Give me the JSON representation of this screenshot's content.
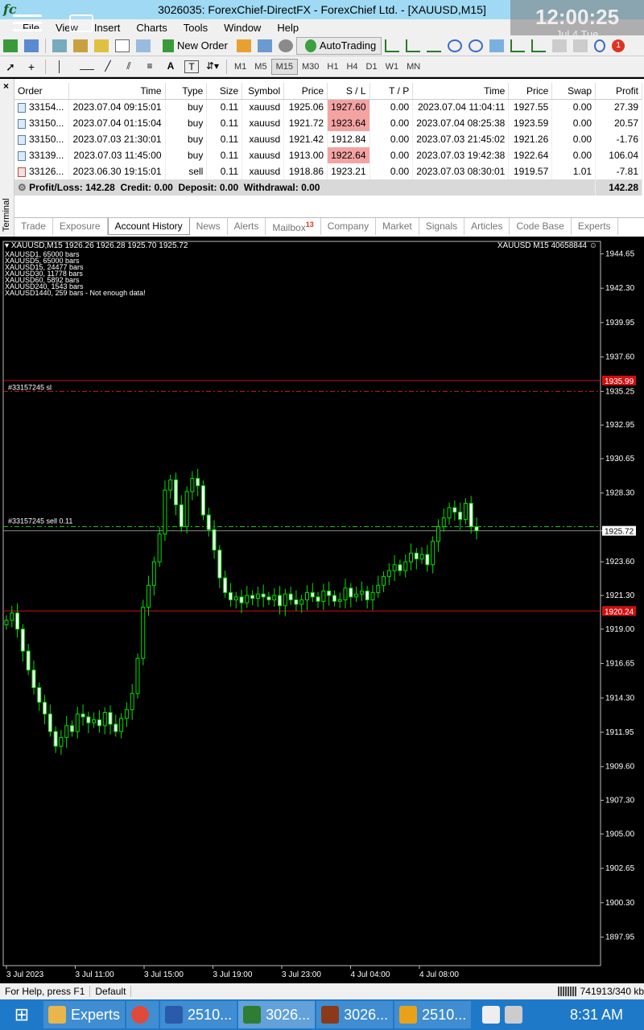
{
  "window": {
    "title": "3026035: ForexChief-DirectFX - ForexChief Ltd. - [XAUUSD,M15]",
    "logo": "fc"
  },
  "overlay": {
    "time": "12:00:25",
    "date": "Jul 4 Tue"
  },
  "menu": [
    "File",
    "View",
    "Insert",
    "Charts",
    "Tools",
    "Window",
    "Help"
  ],
  "toolbar": {
    "new_order": "New Order",
    "autotrading": "AutoTrading",
    "alert_badge": "1"
  },
  "timeframes": [
    "M1",
    "M5",
    "M15",
    "M30",
    "H1",
    "H4",
    "D1",
    "W1",
    "MN"
  ],
  "active_timeframe": "M15",
  "terminal": {
    "close": "×",
    "side_label": "Terminal",
    "columns": [
      "Order",
      "Time",
      "Type",
      "Size",
      "Symbol",
      "Price",
      "S / L",
      "T / P",
      "Time",
      "Price",
      "Swap",
      "Profit"
    ],
    "rows": [
      {
        "order": "33154...",
        "time": "2023.07.04 09:15:01",
        "type": "buy",
        "size": "0.11",
        "symbol": "xauusd",
        "price": "1925.06",
        "sl": "1927.60",
        "tp": "0.00",
        "ctime": "2023.07.04 11:04:11",
        "cprice": "1927.55",
        "swap": "0.00",
        "profit": "27.39",
        "sl_hit": true
      },
      {
        "order": "33150...",
        "time": "2023.07.04 01:15:04",
        "type": "buy",
        "size": "0.11",
        "symbol": "xauusd",
        "price": "1921.72",
        "sl": "1923.64",
        "tp": "0.00",
        "ctime": "2023.07.04 08:25:38",
        "cprice": "1923.59",
        "swap": "0.00",
        "profit": "20.57",
        "sl_hit": true
      },
      {
        "order": "33150...",
        "time": "2023.07.03 21:30:01",
        "type": "buy",
        "size": "0.11",
        "symbol": "xauusd",
        "price": "1921.42",
        "sl": "1912.84",
        "tp": "0.00",
        "ctime": "2023.07.03 21:45:02",
        "cprice": "1921.26",
        "swap": "0.00",
        "profit": "-1.76",
        "sl_hit": false
      },
      {
        "order": "33139...",
        "time": "2023.07.03 11:45:00",
        "type": "buy",
        "size": "0.11",
        "symbol": "xauusd",
        "price": "1913.00",
        "sl": "1922.64",
        "tp": "0.00",
        "ctime": "2023.07.03 19:42:38",
        "cprice": "1922.64",
        "swap": "0.00",
        "profit": "106.04",
        "sl_hit": true
      },
      {
        "order": "33126...",
        "time": "2023.06.30 19:15:01",
        "type": "sell",
        "size": "0.11",
        "symbol": "xauusd",
        "price": "1918.86",
        "sl": "1923.21",
        "tp": "0.00",
        "ctime": "2023.07.03 08:30:01",
        "cprice": "1919.57",
        "swap": "1.01",
        "profit": "-7.81",
        "sl_hit": false
      }
    ],
    "summary": "Profit/Loss: 142.28  Credit: 0.00  Deposit: 0.00  Withdrawal: 0.00",
    "summary_total": "142.28",
    "tabs": [
      "Trade",
      "Exposure",
      "Account History",
      "News",
      "Alerts",
      "Mailbox",
      "Company",
      "Market",
      "Signals",
      "Articles",
      "Code Base",
      "Experts"
    ],
    "mailbox_count": "13",
    "active_tab": "Account History"
  },
  "chart_panel": {
    "header": "XAUUSD,M15  1926.26 1926.28 1925.70 1925.72",
    "header_right": "XAUUSD M15 40658844",
    "info_lines": [
      "XAUUSD1, 65000 bars",
      "XAUUSD5, 65000 bars",
      "XAUUSD15, 24477 bars",
      "XAUUSD30, 11778 bars",
      "XAUUSD60, 5892 bars",
      "XAUUSD240, 1543 bars",
      "XAUUSD1440, 259 bars - Not enough data!"
    ],
    "sl_label": "#33157245 sl",
    "order_label": "#33157245 sell 0.11"
  },
  "chart_data": {
    "type": "candlestick",
    "symbol": "XAUUSD",
    "timeframe": "M15",
    "y_ticks": [
      1944.65,
      1942.3,
      1939.95,
      1937.6,
      1935.25,
      1932.95,
      1930.65,
      1928.3,
      1925.72,
      1923.6,
      1921.3,
      1919.0,
      1916.65,
      1914.3,
      1911.95,
      1909.6,
      1907.3,
      1905.0,
      1902.65,
      1900.3,
      1897.95
    ],
    "ylim": [
      1896.0,
      1945.5
    ],
    "x_ticks": [
      "3 Jul 2023",
      "3 Jul 11:00",
      "3 Jul 15:00",
      "3 Jul 19:00",
      "3 Jul 23:00",
      "4 Jul 04:00",
      "4 Jul 08:00"
    ],
    "markers": [
      {
        "label": "1935.99",
        "value": 1935.99,
        "color": "#d01010"
      },
      {
        "label": "1925.72",
        "value": 1925.72,
        "color": "#ffffff"
      },
      {
        "label": "1920.24",
        "value": 1920.24,
        "color": "#d01010"
      }
    ],
    "sl_level": 1935.25,
    "order_level": 1926.0,
    "close_series": [
      1919.6,
      1920.1,
      1919.0,
      1917.5,
      1916.2,
      1915.0,
      1914.0,
      1913.2,
      1912.0,
      1911.0,
      1911.6,
      1912.4,
      1912.0,
      1913.2,
      1913.0,
      1912.6,
      1912.8,
      1912.4,
      1913.3,
      1912.5,
      1912.0,
      1912.9,
      1913.5,
      1914.6,
      1917.0,
      1920.5,
      1922.0,
      1923.6,
      1925.5,
      1928.5,
      1929.2,
      1927.5,
      1926.0,
      1928.4,
      1929.3,
      1928.8,
      1926.8,
      1925.8,
      1924.4,
      1922.5,
      1921.5,
      1921.0,
      1921.2,
      1920.8,
      1921.3,
      1921.1,
      1921.4,
      1921.2,
      1921.0,
      1921.3,
      1920.6,
      1921.4,
      1921.0,
      1920.7,
      1921.0,
      1921.5,
      1921.2,
      1920.9,
      1921.6,
      1921.3,
      1920.9,
      1921.0,
      1921.8,
      1921.2,
      1921.4,
      1921.6,
      1921.0,
      1921.5,
      1922.0,
      1922.6,
      1923.0,
      1923.4,
      1923.0,
      1923.6,
      1924.2,
      1923.8,
      1924.1,
      1923.4,
      1925.0,
      1926.0,
      1926.6,
      1927.3,
      1927.0,
      1926.5,
      1927.6,
      1926.0,
      1925.72
    ]
  },
  "status": {
    "help": "For Help, press F1",
    "profile": "Default",
    "traffic": "741913/340 kb"
  },
  "taskbar": {
    "items": [
      {
        "label": "Experts",
        "color": "#e8b64a"
      },
      {
        "label": "",
        "color": "#e04a3a"
      },
      {
        "label": "2510...",
        "color": "#2a5aa8"
      },
      {
        "label": "3026...",
        "color": "#2e7d32"
      },
      {
        "label": "3026...",
        "color": "#8a3a1a"
      },
      {
        "label": "2510...",
        "color": "#e8a21a"
      }
    ],
    "clock": "8:31 AM"
  }
}
